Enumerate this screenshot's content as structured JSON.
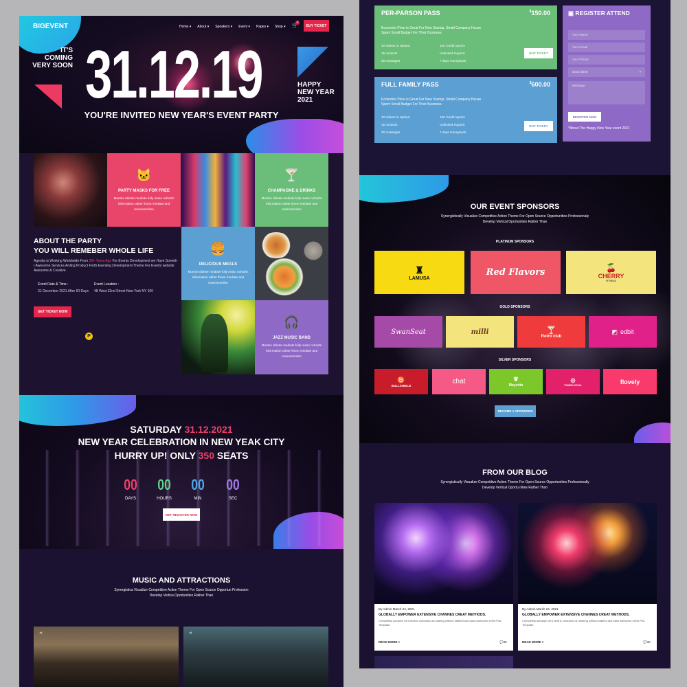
{
  "brand": "BIGEVENT",
  "nav": {
    "items": [
      "Home ▾",
      "About ▾",
      "Speakers ▾",
      "Event ▾",
      "Pages ▾",
      "Shop ▾"
    ],
    "cart_count": "0",
    "ticket_button": "BUY TICKET"
  },
  "hero": {
    "coming": [
      "IT'S",
      "COMING",
      "VERY SOON"
    ],
    "date": "31.12.19",
    "invite": "YOU'RE INVITED NEW YEAR'S EVENT PARTY",
    "happy": [
      "HAPPY",
      "NEW YEAR",
      "2021"
    ]
  },
  "tiles": [
    {
      "title": "PARTY MASKS FOR FREE",
      "desc": "Montne dsinter mediate fully reaso nchodm information rather thonn mediate and reasonsonline",
      "icon": "cat-icon",
      "color": "#e9456a"
    },
    {
      "title": "CHAMPAGNE & DRINKS",
      "desc": "Montne dsinter mediate fully reaso nchodm information rather thonn mediate and reasonsonline",
      "icon": "cocktail-icon",
      "color": "#6bbe79"
    },
    {
      "title": "DELICIOUS MEALS",
      "desc": "Montne dsinter mediate fully reaso nchodm information rather thonn mediate and reasonsonline",
      "icon": "burger-icon",
      "color": "#5b9fd3"
    },
    {
      "title": "JAZZ MUSIC BAND",
      "desc": "Montne dsinter mediate fully reaso nchodm information rather thonn mediate and reasonsonline",
      "icon": "headphones-icon",
      "color": "#8e69c6"
    }
  ],
  "about": {
    "heading1": "ABOUT THE PARTY",
    "heading2": "YOU WILL REMEBER WHOLE LIFE",
    "text_a": "Agentia is Working Worldwide From",
    "highlight": "20+ Years Ago",
    "text_b": "For Events Development we Have",
    "text_c": "Someth I Awesome Services Arding Product Forth Eventing Development Theme For Events",
    "text_d": "website Awesome & Creative",
    "date_label": "Event Date & Time :",
    "date_value": "31 December 2021 After 60 Days",
    "location_label": "Event Location :",
    "location_value": "48 West 32nd Street New York NY 100",
    "button": "GET TICKET NOW"
  },
  "countdown": {
    "line1_a": "SATURDAY",
    "line1_b": "31.12.2021",
    "line2": "NEW YEAR CELEBRATION IN NEW YEAK CITY",
    "line3_a": "HURRY UP! ONLY",
    "line3_b": "350",
    "line3_c": "SEATS",
    "units": [
      {
        "value": "00",
        "label": "DAYS",
        "color": "#f0406a"
      },
      {
        "value": "00",
        "label": "HOURS",
        "color": "#5fcf8a"
      },
      {
        "value": "00",
        "label": "MIN",
        "color": "#4fa6e6"
      },
      {
        "value": "00",
        "label": "SEC",
        "color": "#9f78e0"
      }
    ],
    "button": "GET REGISTER NOW"
  },
  "music": {
    "title": "MUSIC AND ATTRACTIONS",
    "sub1": "Synergistica Visualize Competitive Action Theme For Open Source Opportun Profession",
    "sub2": "Develop Vertica Oportunities Rather Than"
  },
  "pricing": [
    {
      "name": "PER-PARSON PASS",
      "currency": "$",
      "price": "150.00",
      "color": "#6bbe79",
      "desc1": "Economic Price is Great For New Startup, Small Company House",
      "desc2": "Spent Small Budget For Their Business.",
      "features": [
        "40 Videos to Upload",
        "100 Credit reports",
        "15 contacts",
        "Unlimited Support",
        "30 massages",
        "7 days moneyback"
      ],
      "button": "BUY TICKET"
    },
    {
      "name": "FULL FAMILY PASS",
      "currency": "$",
      "price": "600.00",
      "color": "#5b9fd3",
      "desc1": "Economic Price is Great For New Startup, Small Company House",
      "desc2": "Spent Small Budget For Their Business.",
      "features": [
        "40 Videos to Upload",
        "100 Credit reports",
        "15 contacts",
        "Unlimited Support",
        "30 massages",
        "7 days moneyback"
      ],
      "button": "BUY TICKET"
    }
  ],
  "register": {
    "title": "REGISTER ATTEND",
    "name": "Your Name",
    "email": "Your Email",
    "phone": "Your Phone",
    "select": "Basic $100",
    "message": "Message",
    "button": "REGISTER NOW",
    "note": "*About The Happy New Year event 2021"
  },
  "sponsors": {
    "title": "OUR EVENT SPONSORS",
    "sub1": "Synergistically Visualize Competitive Action Theme For Open Source Opportunities Professionaly",
    "sub2": "Develop Vertical Oportunities Rather Than",
    "platinum_label": "PLATINUM SPONSORS",
    "gold_label": "GOLD SPONSORS",
    "silver_label": "SILVER SPONSORS",
    "platinum": [
      {
        "name": "LAMUSA",
        "color": "#f8da13",
        "text": "#111111"
      },
      {
        "name": "Red Flavors",
        "color": "#ef5767",
        "text": "#ffffff"
      },
      {
        "name": "CHERRY",
        "sub": "FITNESS",
        "color": "#f3e47e",
        "text": "#c9252c"
      }
    ],
    "gold": [
      {
        "name": "SwanSeat",
        "color": "#a64aa8",
        "text": "#ffffff"
      },
      {
        "name": "milli",
        "color": "#f3e47e",
        "text": "#6b3a1c"
      },
      {
        "name": "Retro club",
        "color": "#ef3b3b",
        "text": "#ffffff"
      },
      {
        "name": "edbit",
        "color": "#e0218a",
        "text": "#ffffff"
      }
    ],
    "silver": [
      {
        "name": "BULLSHIELD",
        "color": "#c91c2b",
        "text": "#ffffff"
      },
      {
        "name": "chat",
        "color": "#f55a86",
        "text": "#ffffff"
      },
      {
        "name": "Mayurita",
        "color": "#7cc72a",
        "text": "#ffffff"
      },
      {
        "name": "THINKLOCAL",
        "color": "#e2216a",
        "text": "#ffffff"
      },
      {
        "name": "flovely",
        "color": "#f83a6c",
        "text": "#ffffff"
      }
    ],
    "button": "BECOME A SPONSORS"
  },
  "blog": {
    "title": "FROM OUR BLOG",
    "sub1": "Synergistically Visualize Competitive Action Theme For Open Source Opportunities Professionally",
    "sub2": "Develop Vertical Oportu nities Rather Than",
    "posts": [
      {
        "meta": "By Admin March 24, 2021",
        "title": "GLOBALLY EMPOWER EXTENSIVE CHANNES CREAT METHODS.",
        "excerpt": "Completely actuaize cent centric coloration an sharing without stateful and base awesome event Psd Template.",
        "read": "READ MORE >",
        "comments": "30"
      },
      {
        "meta": "By Admin March 24, 2021",
        "title": "GLOBALLY EMPOWER EXTENSIVE CHANNES CREAT METHODS.",
        "excerpt": "Completely actuaize cent centric coloration an sharing without stateful and base awesome event Psd Template.",
        "read": "READ MORE >",
        "comments": "30"
      }
    ]
  }
}
